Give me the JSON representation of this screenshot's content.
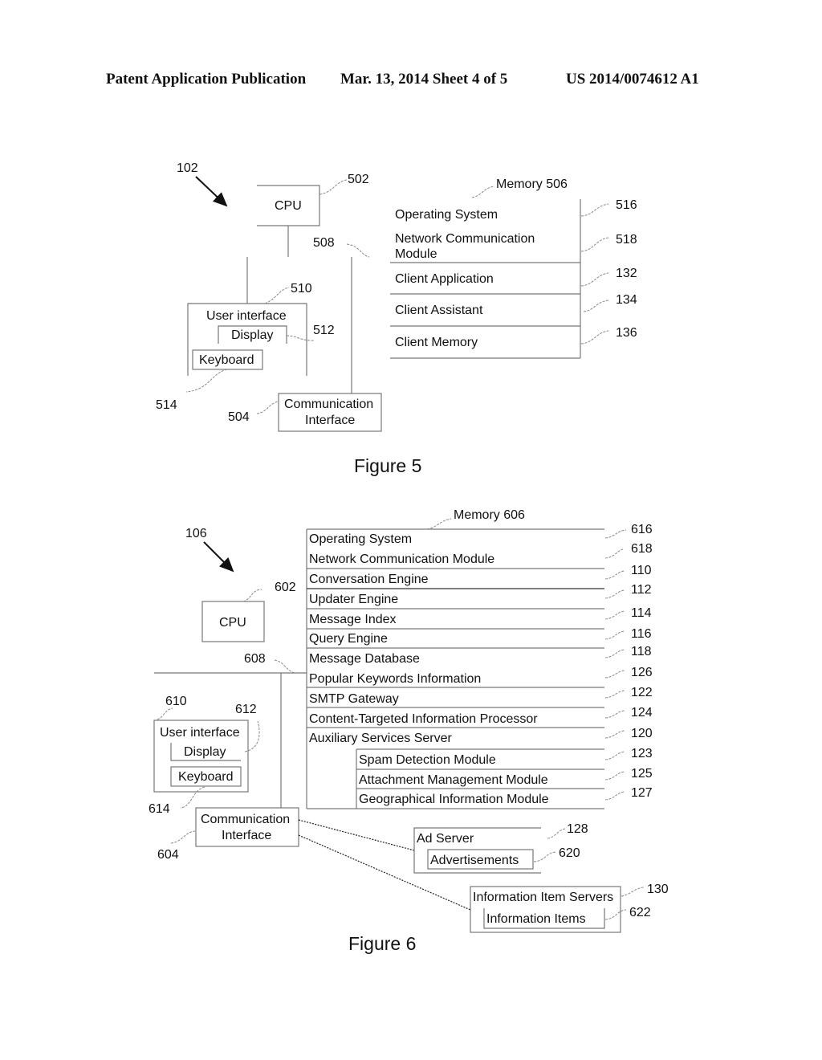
{
  "header": {
    "publication": "Patent Application Publication",
    "date_sheet": "Mar. 13, 2014  Sheet 4 of 5",
    "pub_number": "US 2014/0074612 A1"
  },
  "figure5": {
    "caption": "Figure 5",
    "ref_device": "102",
    "cpu": {
      "label": "CPU",
      "ref": "502"
    },
    "bus_ref": "508",
    "user_interface": {
      "label": "User interface",
      "ref": "510"
    },
    "display": {
      "label": "Display",
      "ref": "512"
    },
    "keyboard": {
      "label": "Keyboard",
      "ref": "514"
    },
    "comm_interface": {
      "line1": "Communication",
      "line2": "Interface",
      "ref": "504"
    },
    "memory": {
      "label": "Memory 506",
      "rows": [
        {
          "label": "Operating System",
          "ref": "516"
        },
        {
          "label": "Network Communication",
          "label2": "Module",
          "ref": "518"
        },
        {
          "label": "Client Application",
          "ref": "132"
        },
        {
          "label": "Client Assistant",
          "ref": "134"
        },
        {
          "label": "Client Memory",
          "ref": "136"
        }
      ]
    }
  },
  "figure6": {
    "caption": "Figure 6",
    "ref_device": "106",
    "cpu": {
      "label": "CPU",
      "ref": "602"
    },
    "bus_ref": "608",
    "user_interface": {
      "label": "User interface",
      "ref": "610"
    },
    "display": {
      "label": "Display",
      "ref": "612"
    },
    "keyboard": {
      "label": "Keyboard",
      "ref": "614"
    },
    "comm_interface": {
      "line1": "Communication",
      "line2": "Interface",
      "ref": "604"
    },
    "memory": {
      "label": "Memory 606",
      "rows": [
        {
          "label": "Operating System",
          "ref": "616"
        },
        {
          "label": "Network Communication Module",
          "ref": "618"
        },
        {
          "label": "Conversation Engine",
          "ref": "110"
        },
        {
          "label": "Updater Engine",
          "ref": "112"
        },
        {
          "label": "Message Index",
          "ref": "114"
        },
        {
          "label": "Query Engine",
          "ref": "116"
        },
        {
          "label": "Message Database",
          "ref": "118"
        },
        {
          "label": "Popular Keywords Information",
          "ref": "126"
        },
        {
          "label": "SMTP Gateway",
          "ref": "122"
        },
        {
          "label": "Content-Targeted Information Processor",
          "ref": "124"
        },
        {
          "label": "Auxiliary Services Server",
          "ref": "120"
        }
      ],
      "sub_rows": [
        {
          "label": "Spam Detection Module",
          "ref": "123"
        },
        {
          "label": "Attachment Management Module",
          "ref": "125"
        },
        {
          "label": "Geographical Information Module",
          "ref": "127"
        }
      ]
    },
    "ad_server": {
      "label": "Ad Server",
      "ref": "128",
      "inner": "Advertisements",
      "inner_ref": "620"
    },
    "info_servers": {
      "label": "Information Item Servers",
      "ref": "130",
      "inner": "Information Items",
      "inner_ref": "622"
    }
  }
}
